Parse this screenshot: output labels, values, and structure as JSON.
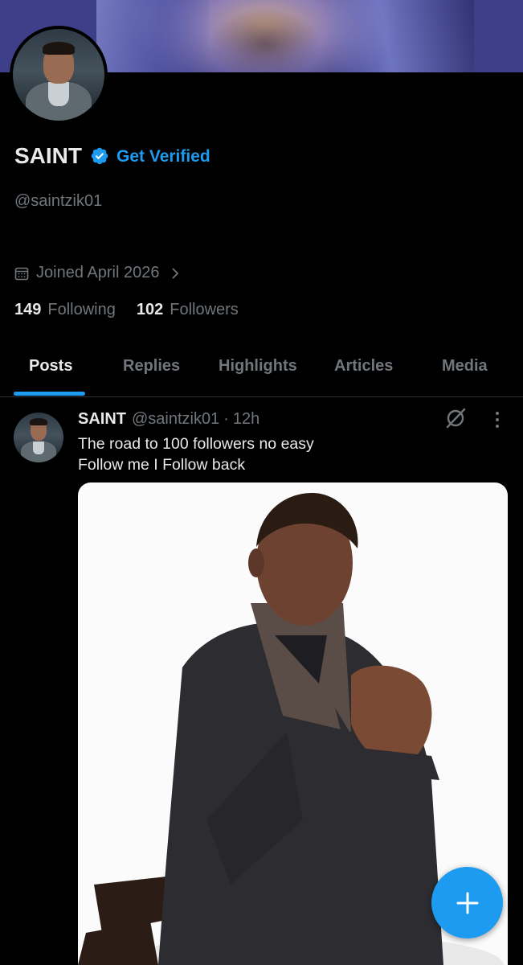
{
  "profile": {
    "display_name": "SAINT",
    "get_verified_label": "Get Verified",
    "handle": "@saintzik01",
    "joined": "Joined April 2026",
    "following_count": "149",
    "following_label": "Following",
    "followers_count": "102",
    "followers_label": "Followers"
  },
  "tabs": [
    {
      "label": "Posts",
      "active": true
    },
    {
      "label": "Replies"
    },
    {
      "label": "Highlights"
    },
    {
      "label": "Articles"
    },
    {
      "label": "Media"
    }
  ],
  "post": {
    "name": "SAINT",
    "handle": "@saintzik01",
    "separator": "·",
    "time": "12h",
    "text_line1": "The road to 100 followers no easy",
    "text_line2": "Follow me I Follow back"
  },
  "icons": {
    "verified": "verified-badge-icon",
    "calendar": "calendar-icon",
    "chevron": "chevron-right-icon",
    "grok": "grok-icon",
    "more": "more-vertical-icon",
    "compose": "plus-icon"
  },
  "colors": {
    "accent": "#1d9bf0",
    "text_primary": "#e7e9ea",
    "text_secondary": "#71767b",
    "background": "#000000"
  }
}
